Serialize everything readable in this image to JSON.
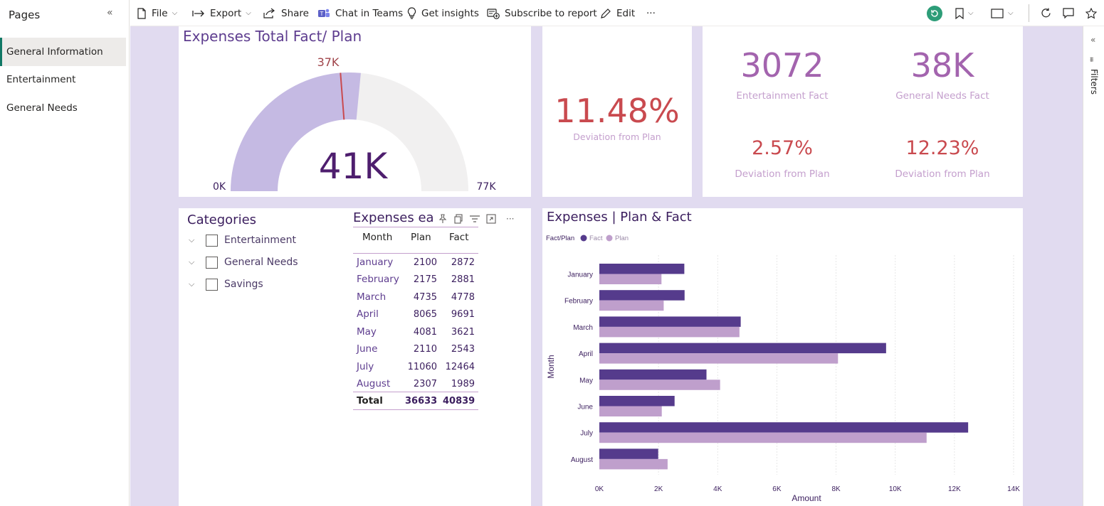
{
  "pages_pane": {
    "title": "Pages",
    "items": [
      "General Information",
      "Entertainment",
      "General Needs"
    ],
    "active_index": 0
  },
  "toolbar": {
    "file": "File",
    "export": "Export",
    "share": "Share",
    "teams": "Chat in Teams",
    "insights": "Get insights",
    "subscribe": "Subscribe to report",
    "edit": "Edit",
    "more": "···"
  },
  "filters_pane": {
    "label": "Filters"
  },
  "gauge": {
    "title": "Expenses Total Fact/ Plan",
    "value_label": "41K",
    "target_label": "37K",
    "min_label": "0K",
    "max_label": "77K",
    "min": 0,
    "max": 77000,
    "value": 40839,
    "target": 36633,
    "fill_color": "#c5bae3",
    "track_color": "#f1f0f0",
    "target_color": "#c94a4f"
  },
  "kpi_total": {
    "value": "11.48%",
    "label": "Deviation from Plan"
  },
  "kpi_entertainment": {
    "value": "3072",
    "label": "Entertainment Fact",
    "dev_value": "2.57%",
    "dev_label": "Deviation from Plan"
  },
  "kpi_general": {
    "value": "38K",
    "label": "General Needs Fact",
    "dev_value": "12.23%",
    "dev_label": "Deviation from Plan"
  },
  "categories": {
    "title": "Categories",
    "items": [
      "Entertainment",
      "General Needs",
      "Savings"
    ]
  },
  "table": {
    "title": "Expenses ea",
    "columns": [
      "Month",
      "Plan",
      "Fact"
    ],
    "rows": [
      [
        "January",
        "2100",
        "2872"
      ],
      [
        "February",
        "2175",
        "2881"
      ],
      [
        "March",
        "4735",
        "4778"
      ],
      [
        "April",
        "8065",
        "9691"
      ],
      [
        "May",
        "4081",
        "3621"
      ],
      [
        "June",
        "2110",
        "2543"
      ],
      [
        "July",
        "11060",
        "12464"
      ],
      [
        "August",
        "2307",
        "1989"
      ]
    ],
    "total": [
      "Total",
      "36633",
      "40839"
    ]
  },
  "chart_data": {
    "type": "bar",
    "orientation": "horizontal",
    "title": "Expenses | Plan & Fact",
    "legend_title": "Fact/Plan",
    "legend_position": "top-left",
    "categories": [
      "January",
      "February",
      "March",
      "April",
      "May",
      "June",
      "July",
      "August"
    ],
    "series": [
      {
        "name": "Fact",
        "values": [
          2872,
          2881,
          4778,
          9691,
          3621,
          2543,
          12464,
          1989
        ],
        "color": "#553b8c"
      },
      {
        "name": "Plan",
        "values": [
          2100,
          2175,
          4735,
          8065,
          4081,
          2110,
          11060,
          2307
        ],
        "color": "#bf9fcc"
      }
    ],
    "xlabel": "Amount",
    "ylabel": "Month",
    "xlim": [
      0,
      14000
    ],
    "xticks": [
      0,
      2000,
      4000,
      6000,
      8000,
      10000,
      12000,
      14000
    ],
    "xtick_labels": [
      "0K",
      "2K",
      "4K",
      "6K",
      "8K",
      "10K",
      "12K",
      "14K"
    ],
    "grid": true
  }
}
